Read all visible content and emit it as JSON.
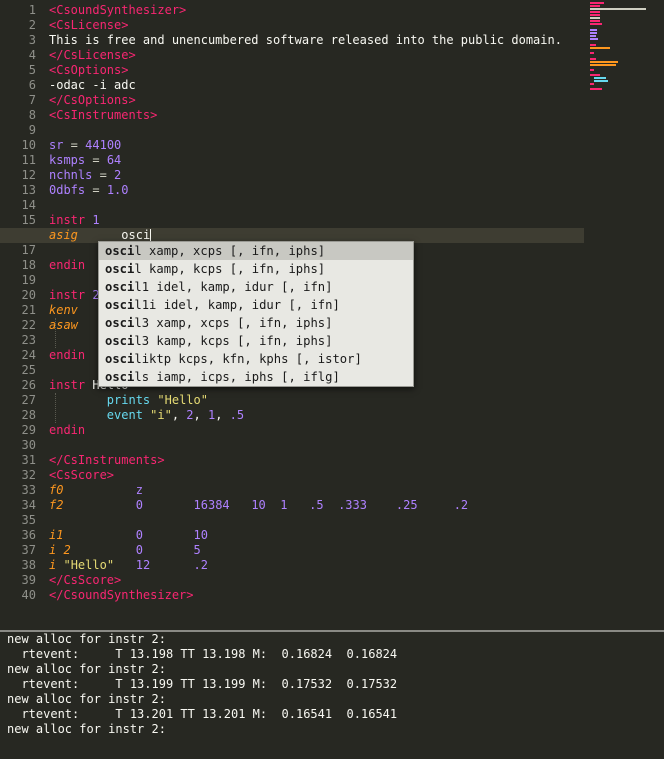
{
  "editor": {
    "line_numbers": [
      "1",
      "2",
      "3",
      "4",
      "5",
      "6",
      "7",
      "8",
      "9",
      "10",
      "11",
      "12",
      "13",
      "14",
      "15",
      "16",
      "17",
      "18",
      "19",
      "20",
      "21",
      "22",
      "23",
      "24",
      "25",
      "26",
      "27",
      "28",
      "29",
      "30",
      "31",
      "32",
      "33",
      "34",
      "35",
      "36",
      "37",
      "38",
      "39",
      "40"
    ],
    "active_line": 16,
    "lines": {
      "l1": "<CsoundSynthesizer>",
      "l2": "<CsLicense>",
      "l3": "This is free and unencumbered software released into the public domain.",
      "l4": "</CsLicense>",
      "l5": "<CsOptions>",
      "l6": "-odac -i adc",
      "l7": "</CsOptions>",
      "l8": "<CsInstruments>",
      "l10a": "sr",
      "l10b": " = ",
      "l10c": "44100",
      "l11a": "ksmps",
      "l11b": " = ",
      "l11c": "64",
      "l12a": "nchnls",
      "l12b": " = ",
      "l12c": "2",
      "l13a": "0dbfs",
      "l13b": " = ",
      "l13c": "1.0",
      "l15a": "instr",
      "l15b": " 1",
      "l16a": "asig",
      "l16b": "osci",
      "l18": "endin",
      "l20a": "instr",
      "l20b": " 2",
      "l21": "kenv",
      "l22": "asaw",
      "l24": "endin",
      "l26a": "instr",
      "l26b": " Hello",
      "l27a": "prints",
      "l27b": "\"Hello\"",
      "l28a": "event",
      "l28b": "\"i\"",
      "l28c": ", ",
      "l28d": "2",
      "l28e": ", ",
      "l28f": "1",
      "l28g": ", ",
      "l28h": ".5",
      "l29": "endin",
      "l31": "</CsInstruments>",
      "l32": "<CsScore>",
      "l33a": "f0",
      "l33b": "z",
      "l34a": "f2",
      "l34b": "0",
      "l34c": "16384",
      "l34d": "10",
      "l34e": "1",
      "l34f": ".5",
      "l34g": ".333",
      "l34h": ".25",
      "l34i": ".2",
      "l36a": "i1",
      "l36b": "0",
      "l36c": "10",
      "l37a": "i 2",
      "l37b": "0",
      "l37c": "5",
      "l38a": "i",
      "l38b": "\"Hello\"",
      "l38c": "12",
      "l38d": ".2",
      "l39": "</CsScore>",
      "l40": "</CsoundSynthesizer>"
    }
  },
  "autocomplete": {
    "typed": "osci",
    "items": [
      {
        "match": "osci",
        "rest": "l xamp, xcps [, ifn, iphs]"
      },
      {
        "match": "osci",
        "rest": "l kamp, kcps [, ifn, iphs]"
      },
      {
        "match": "osci",
        "rest": "l1 idel, kamp, idur [, ifn]"
      },
      {
        "match": "osci",
        "rest": "l1i idel, kamp, idur [, ifn]"
      },
      {
        "match": "osci",
        "rest": "l3 xamp, xcps [, ifn, iphs]"
      },
      {
        "match": "osci",
        "rest": "l3 kamp, kcps [, ifn, iphs]"
      },
      {
        "match": "osci",
        "rest": "liktp kcps, kfn, kphs [, istor]"
      },
      {
        "match": "osci",
        "rest": "ls iamp, icps, iphs [, iflg]"
      }
    ],
    "selected_index": 0
  },
  "console": {
    "lines": [
      "new alloc for instr 2:",
      "  rtevent:     T 13.198 TT 13.198 M:  0.16824  0.16824",
      "new alloc for instr 2:",
      "  rtevent:     T 13.199 TT 13.199 M:  0.17532  0.17532",
      "new alloc for instr 2:",
      "  rtevent:     T 13.201 TT 13.201 M:  0.16541  0.16541",
      "new alloc for instr 2:"
    ]
  },
  "colors": {
    "background": "#272822",
    "tag": "#f92672",
    "number": "#ae81ff",
    "variable": "#fd971f",
    "string": "#e6db74",
    "function": "#66d9ef",
    "text": "#f8f8f2"
  }
}
